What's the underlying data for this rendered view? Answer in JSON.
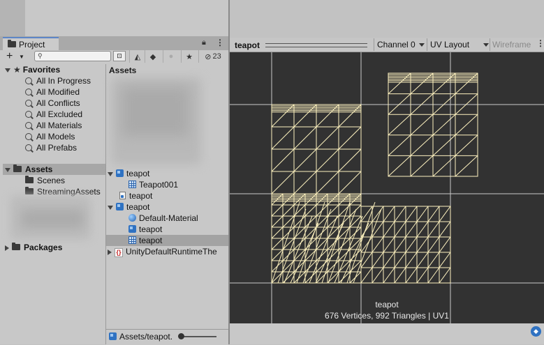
{
  "project_panel": {
    "tab_label": "Project",
    "hidden_count": "23",
    "search_placeholder": "",
    "favorites": {
      "label": "Favorites",
      "items": [
        "All In Progress",
        "All Modified",
        "All Conflicts",
        "All Excluded",
        "All Materials",
        "All Models",
        "All Prefabs"
      ]
    },
    "assets": {
      "label": "Assets",
      "children": [
        "Scenes",
        "StreamingAssets"
      ]
    },
    "packages_label": "Packages"
  },
  "assets_list": {
    "header": "Assets",
    "items": [
      {
        "label": "teapot",
        "icon": "model-prefab-icon"
      },
      {
        "label": "Teapot001",
        "icon": "mesh-icon"
      },
      {
        "label": "teapot",
        "icon": "text-asset-icon"
      },
      {
        "label": "teapot",
        "icon": "model-prefab-icon"
      },
      {
        "label": "Default-Material",
        "icon": "material-icon"
      },
      {
        "label": "teapot",
        "icon": "model-prefab-icon"
      },
      {
        "label": "teapot",
        "icon": "mesh-icon"
      },
      {
        "label": "UnityDefaultRuntimeThe",
        "icon": "json-braces-icon"
      }
    ],
    "selected_path": "Assets/teapot."
  },
  "preview": {
    "title": "teapot",
    "channel": "Channel 0",
    "layout": "UV Layout",
    "wireframe_label": "Wireframe",
    "mesh_name": "teapot",
    "stats": "676 Vertices, 992 Triangles | UV1",
    "wire_color": "#fff3c0",
    "background_color": "#323232"
  },
  "colors": {
    "accent": "#5d86c7",
    "selection": "#a3a3a3",
    "panel": "#c8c8c8"
  }
}
